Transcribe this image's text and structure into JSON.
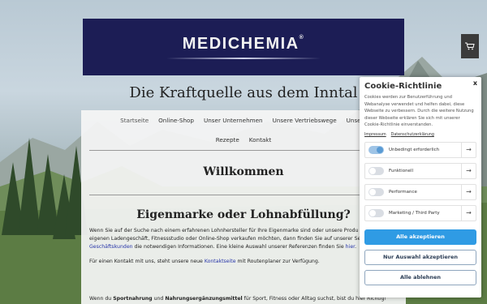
{
  "header": {
    "logo_text": "MEDICHEMIA",
    "logo_mark": "®",
    "tagline": "Die Kraftquelle aus dem Inntal"
  },
  "cart": {
    "icon": "shopping-cart-icon"
  },
  "nav": {
    "row1": [
      "Startseite",
      "Online-Shop",
      "Unser Unternehmen",
      "Unsere Vertriebswege",
      "Unsere"
    ],
    "row2": [
      "Rezepte",
      "Kontakt"
    ]
  },
  "main": {
    "welcome_title": "Willkommen",
    "subtitle": "Eigenmarke oder Lohnabfüllung?",
    "p1_a": "Wenn Sie auf der Suche nach einem erfahrenen Lohnhersteller für Ihre Eigenmarke sind oder unsere Produ",
    "p1_b": "eigenen Ladengeschäft, Fitnessstudio oder Online-Shop verkaufen möchten, dann finden Sie auf unserer Se",
    "p1_link": "Geschäftskunden",
    "p1_c": " die notwendigen Informationen. Eine kleine Auswahl unserer Referenzen finden Sie ",
    "p1_link2": "hier",
    "p1_end": ".",
    "p2_a": "Für einen Kontakt mit uns, steht unsere neue ",
    "p2_link": "Kontaktseite",
    "p2_b": " mit Routenplaner zur Verfügung.",
    "p3_a": "Wenn du ",
    "p3_b1": "Sportnahrung",
    "p3_c": " und ",
    "p3_b2": "Nahrungsergänzungsmittel",
    "p3_d": " für Sport, Fitness oder Alltag suchst, bist du hier Richtig!"
  },
  "cookie": {
    "title": "Cookie-Richtlinie",
    "close": "x",
    "text": "Cookies werden zur Benutzerführung und Webanalyse verwendet und helfen dabei, diese Webseite zu verbessern. Durch die weitere Nutzung dieser Webseite erklären Sie sich mit unserer Cookie-Richtlinie einverstanden.",
    "link_impressum": "Impressum",
    "link_privacy": "Datenschutzerklärung",
    "categories": [
      {
        "label": "Unbedingt erforderlich",
        "enabled": true
      },
      {
        "label": "Funktionell",
        "enabled": false
      },
      {
        "label": "Performance",
        "enabled": false
      },
      {
        "label": "Marketing / Third Party",
        "enabled": false
      }
    ],
    "arrow": "→",
    "btn_accept_all": "Alle akzeptieren",
    "btn_accept_selection": "Nur Auswahl akzeptieren",
    "btn_reject_all": "Alle ablehnen"
  }
}
